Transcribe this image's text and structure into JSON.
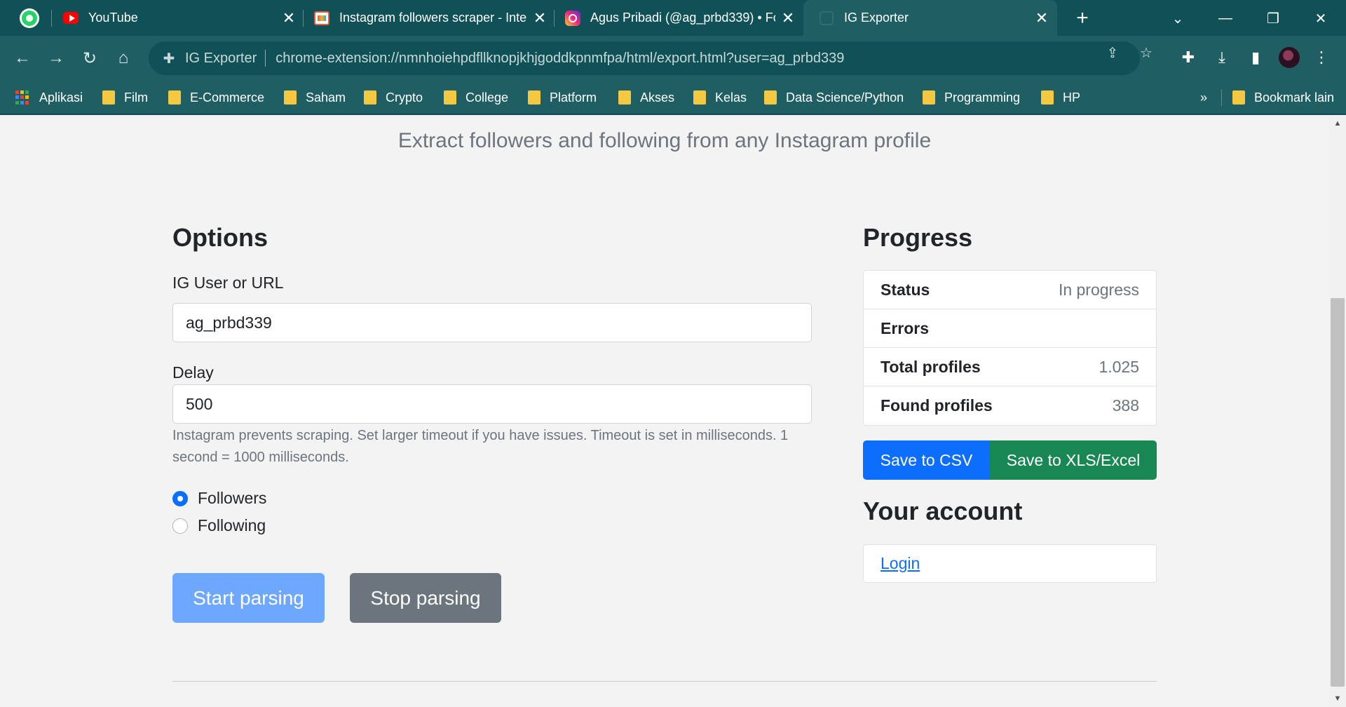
{
  "tabs": [
    {
      "title": "",
      "icon": "whatsapp-icon"
    },
    {
      "title": "YouTube",
      "icon": "youtube-icon"
    },
    {
      "title": "Instagram followers scraper - Inte",
      "icon": "kasten-icon"
    },
    {
      "title": "Agus Pribadi (@ag_prbd339) • Fo",
      "icon": "instagram-icon"
    },
    {
      "title": "IG Exporter",
      "icon": "extension-icon",
      "active": true
    }
  ],
  "address_bar": {
    "site_label": "IG Exporter",
    "url": "chrome-extension://nmnhoiehpdfllknopjkhjgoddkpnmfpa/html/export.html?user=ag_prbd339"
  },
  "bookmarks": {
    "apps_label": "Aplikasi",
    "items": [
      "Film",
      "E-Commerce",
      "Saham",
      "Crypto",
      "College",
      "Platform",
      "Akses",
      "Kelas",
      "Data Science/Python",
      "Programming",
      "HP"
    ],
    "overflow": "»",
    "other": "Bookmark lain"
  },
  "page": {
    "subtitle": "Extract followers and following from any Instagram profile",
    "options": {
      "heading": "Options",
      "user_label": "IG User or URL",
      "user_value": "ag_prbd339",
      "delay_label": "Delay",
      "delay_value": "500",
      "delay_help": "Instagram prevents scraping. Set larger timeout if you have issues. Timeout is set in milliseconds. 1 second = 1000 milliseconds.",
      "radio_followers": "Followers",
      "radio_following": "Following",
      "selected": "Followers",
      "start_button": "Start parsing",
      "stop_button": "Stop parsing"
    },
    "progress": {
      "heading": "Progress",
      "rows": [
        {
          "key": "Status",
          "value": "In progress"
        },
        {
          "key": "Errors",
          "value": ""
        },
        {
          "key": "Total profiles",
          "value": "1.025"
        },
        {
          "key": "Found profiles",
          "value": "388"
        }
      ],
      "csv_button": "Save to CSV",
      "xls_button": "Save to XLS/Excel"
    },
    "account": {
      "heading": "Your account",
      "login_link": "Login"
    }
  },
  "colors": {
    "tab_strip": "#0f5156",
    "toolbar": "#1f5f63",
    "primary": "#0d6efd",
    "primary_disabled": "#6ea8fe",
    "secondary": "#6c757d",
    "success": "#198754"
  }
}
